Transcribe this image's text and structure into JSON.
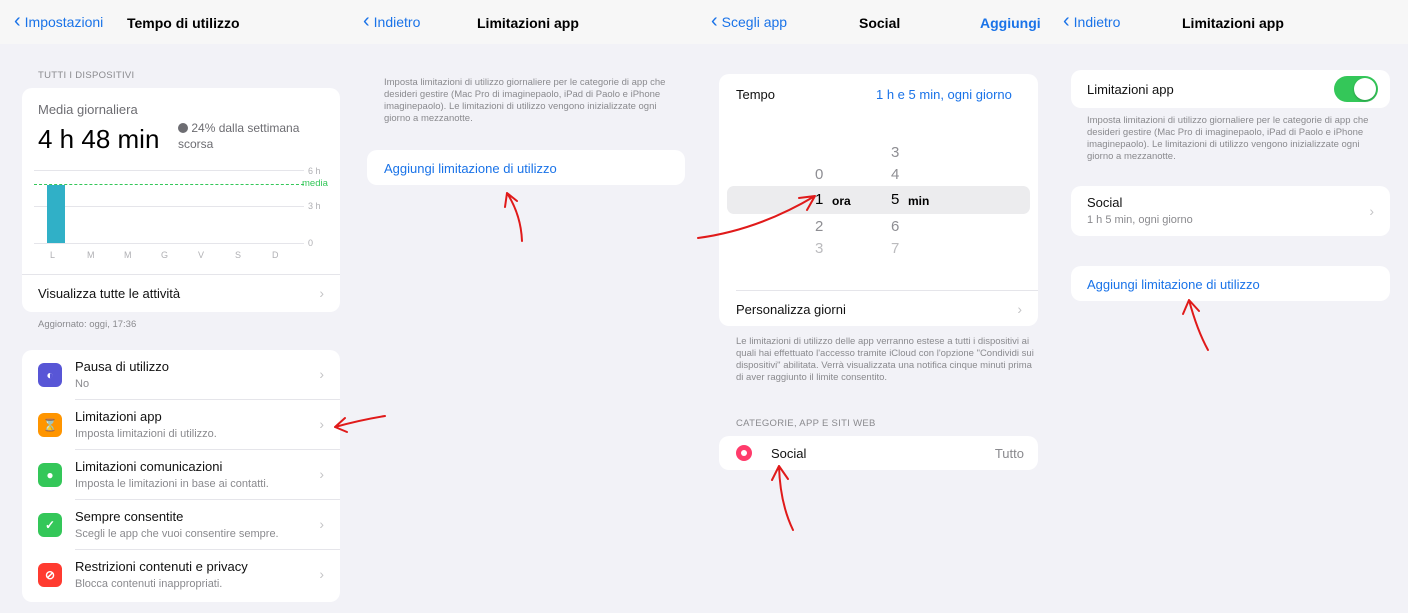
{
  "panel1": {
    "back_label": "Impostazioni",
    "title": "Tempo di utilizzo",
    "section_header": "TUTTI I DISPOSITIVI",
    "daily_avg_label": "Media giornaliera",
    "daily_avg_value": "4 h 48 min",
    "change_line1": "24% dalla settimana",
    "change_line2": "scorsa",
    "scale_top": "6 h",
    "scale_mid": "3 h",
    "scale_zero": "0",
    "avg_label": "media",
    "days": [
      "L",
      "M",
      "M",
      "G",
      "V",
      "S",
      "D"
    ],
    "bar_value_hours": 4.8,
    "see_all": "Visualizza tutte le attività",
    "updated": "Aggiornato: oggi, 17:36",
    "items": [
      {
        "title": "Pausa di utilizzo",
        "subtitle": "No",
        "color": "#5856d6",
        "icon": "hourglass-moon-icon"
      },
      {
        "title": "Limitazioni app",
        "subtitle": "Imposta limitazioni di utilizzo.",
        "color": "#ff9500",
        "icon": "hourglass-icon"
      },
      {
        "title": "Limitazioni comunicazioni",
        "subtitle": "Imposta le limitazioni in base ai contatti.",
        "color": "#34c759",
        "icon": "person-icon"
      },
      {
        "title": "Sempre consentite",
        "subtitle": "Scegli le app che vuoi consentire sempre.",
        "color": "#34c759",
        "icon": "checkmark-icon"
      },
      {
        "title": "Restrizioni contenuti e privacy",
        "subtitle": "Blocca contenuti inappropriati.",
        "color": "#ff3b30",
        "icon": "no-entry-icon"
      }
    ]
  },
  "panel2": {
    "back_label": "Indietro",
    "title": "Limitazioni app",
    "description": "Imposta limitazioni di utilizzo giornaliere per le categorie di app che desideri gestire (Mac Pro di imaginepaolo, iPad di Paolo e iPhone imaginepaolo). Le limitazioni di utilizzo vengono inizializzate ogni giorno a mezzanotte.",
    "add_limit": "Aggiungi limitazione di utilizzo"
  },
  "panel3": {
    "back_label": "Scegli app",
    "title": "Social",
    "action": "Aggiungi",
    "time_label": "Tempo",
    "time_value": "1 h e 5 min, ogni giorno",
    "hours_above": [
      "0"
    ],
    "hours_selected": "1",
    "hours_unit": "ora",
    "hours_below": [
      "2",
      "3"
    ],
    "minutes_above": [
      "3",
      "4"
    ],
    "minutes_selected": "5",
    "minutes_unit": "min",
    "minutes_below": [
      "6",
      "7"
    ],
    "customize_days": "Personalizza giorni",
    "note": "Le limitazioni di utilizzo delle app verranno estese a tutti i dispositivi ai quali hai effettuato l'accesso tramite iCloud con l'opzione \"Condividi sui dispositivi\" abilitata. Verrà visualizzata una notifica cinque minuti prima di aver raggiunto il limite consentito.",
    "section_header": "CATEGORIE, APP E SITI WEB",
    "category_name": "Social",
    "category_value": "Tutto"
  },
  "panel4": {
    "back_label": "Indietro",
    "title": "Limitazioni app",
    "toggle_label": "Limitazioni app",
    "toggle_on": true,
    "description": "Imposta limitazioni di utilizzo giornaliere per le categorie di app che desideri gestire (Mac Pro di imaginepaolo, iPad di Paolo e iPhone imaginepaolo). Le limitazioni di utilizzo vengono inizializzate ogni giorno a mezzanotte.",
    "limit_name": "Social",
    "limit_detail": "1 h 5 min, ogni giorno",
    "add_limit": "Aggiungi limitazione di utilizzo"
  },
  "colors": {
    "accent": "#1a73e8",
    "bar": "#30b0c7",
    "avg_line": "#34c759",
    "toggle": "#34c759",
    "annotation": "#e01a1a"
  }
}
